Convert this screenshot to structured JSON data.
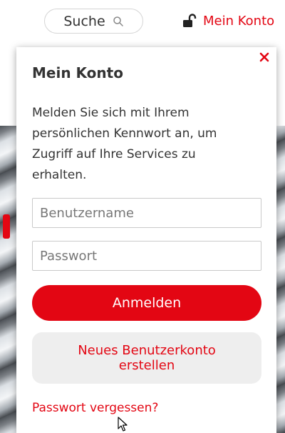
{
  "header": {
    "search_label": "Suche",
    "account_label": "Mein Konto",
    "search_icon": "search-icon",
    "lock_icon": "lock-open-icon"
  },
  "login_flyout": {
    "title": "Mein Konto",
    "description": "Melden Sie sich mit Ihrem persönlichen Kennwort an, um Zugriff auf Ihre Services zu erhalten.",
    "username_placeholder": "Benutzername",
    "password_placeholder": "Passwort",
    "login_button": "Anmelden",
    "register_button": "Neues Benutzerkonto\nerstellen",
    "forgot_link": "Passwort vergessen?",
    "close_icon": "close-icon"
  },
  "colors": {
    "accent": "#e30613",
    "text": "#333333",
    "secondary_button_bg": "#eeeeee"
  }
}
